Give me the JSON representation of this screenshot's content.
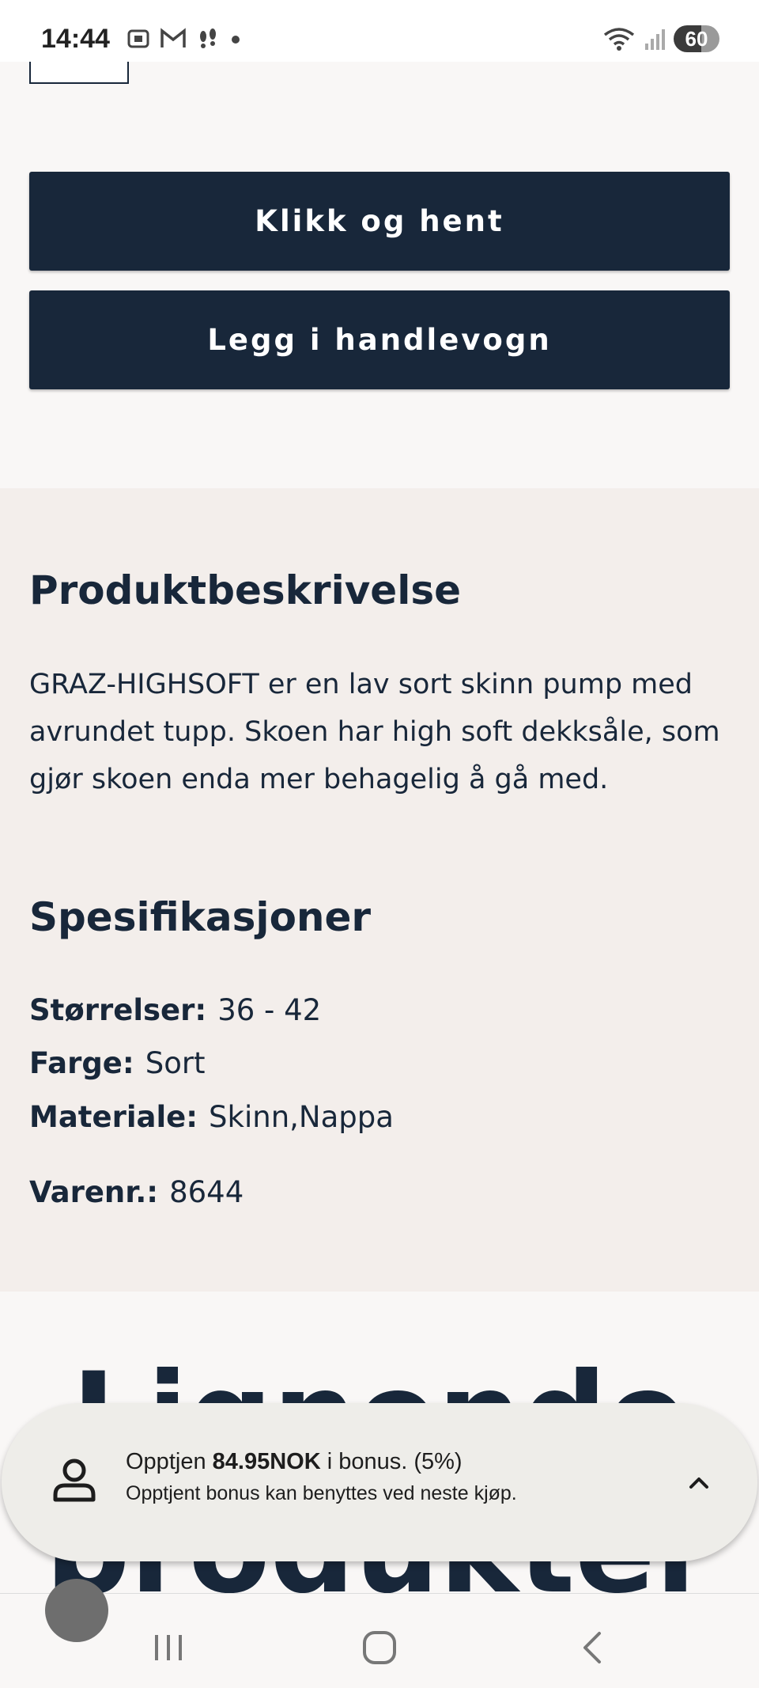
{
  "status_bar": {
    "time": "14:44",
    "battery": "60",
    "icons": [
      "screenshot-icon",
      "gmail-icon",
      "footsteps-icon",
      "dot-icon",
      "wifi-icon",
      "signal-icon"
    ]
  },
  "actions": {
    "click_collect_label": "Klikk og hent",
    "add_to_cart_label": "Legg i handlevogn"
  },
  "description": {
    "title": "Produktbeskrivelse",
    "text": "GRAZ-HIGHSOFT er en lav sort skinn pump med avrundet tupp. Skoen har high soft dekksåle, som gjør skoen enda mer behagelig å gå med."
  },
  "specifications": {
    "title": "Spesifikasjoner",
    "sizes_label": "Størrelser:",
    "sizes_value": "36 - 42",
    "color_label": "Farge:",
    "color_value": "Sort",
    "material_label": "Materiale:",
    "material_value": "Skinn,Nappa",
    "item_no_label": "Varenr.:",
    "item_no_value": "8644"
  },
  "related": {
    "heading": "Lignende produkter"
  },
  "bonus": {
    "prefix": "Opptjen",
    "amount": "84.95NOK",
    "suffix": "i bonus. (5%)",
    "subtext": "Opptjent bonus kan benyttes ved neste kjøp."
  },
  "colors": {
    "primary": "#18273a",
    "page_bg": "#f9f7f6",
    "section_bg": "#f3eeeb",
    "bonus_bg": "#eeede9"
  }
}
